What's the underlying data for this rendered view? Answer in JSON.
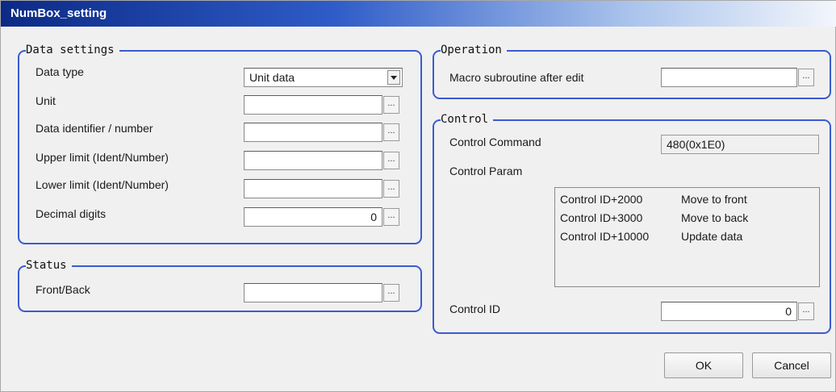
{
  "window": {
    "title": "NumBox_setting"
  },
  "data_settings": {
    "legend": "Data settings",
    "data_type": {
      "label": "Data type",
      "value": "Unit data"
    },
    "unit": {
      "label": "Unit",
      "value": ""
    },
    "data_identifier": {
      "label": "Data identifier / number",
      "value": ""
    },
    "upper_limit": {
      "label": "Upper limit (Ident/Number)",
      "value": ""
    },
    "lower_limit": {
      "label": "Lower limit (Ident/Number)",
      "value": ""
    },
    "decimal_digits": {
      "label": "Decimal digits",
      "value": "0"
    }
  },
  "status": {
    "legend": "Status",
    "front_back": {
      "label": "Front/Back",
      "value": ""
    }
  },
  "operation": {
    "legend": "Operation",
    "macro": {
      "label": "Macro subroutine after edit",
      "value": ""
    }
  },
  "control": {
    "legend": "Control",
    "command": {
      "label": "Control Command",
      "value": "480(0x1E0)"
    },
    "param": {
      "label": "Control Param",
      "rows": [
        {
          "id": "Control ID+2000",
          "action": "Move to front"
        },
        {
          "id": "Control ID+3000",
          "action": "Move to back"
        },
        {
          "id": "Control ID+10000",
          "action": "Update data"
        }
      ]
    },
    "control_id": {
      "label": "Control ID",
      "value": "0"
    }
  },
  "browse_label": "...",
  "buttons": {
    "ok": "OK",
    "cancel": "Cancel"
  }
}
